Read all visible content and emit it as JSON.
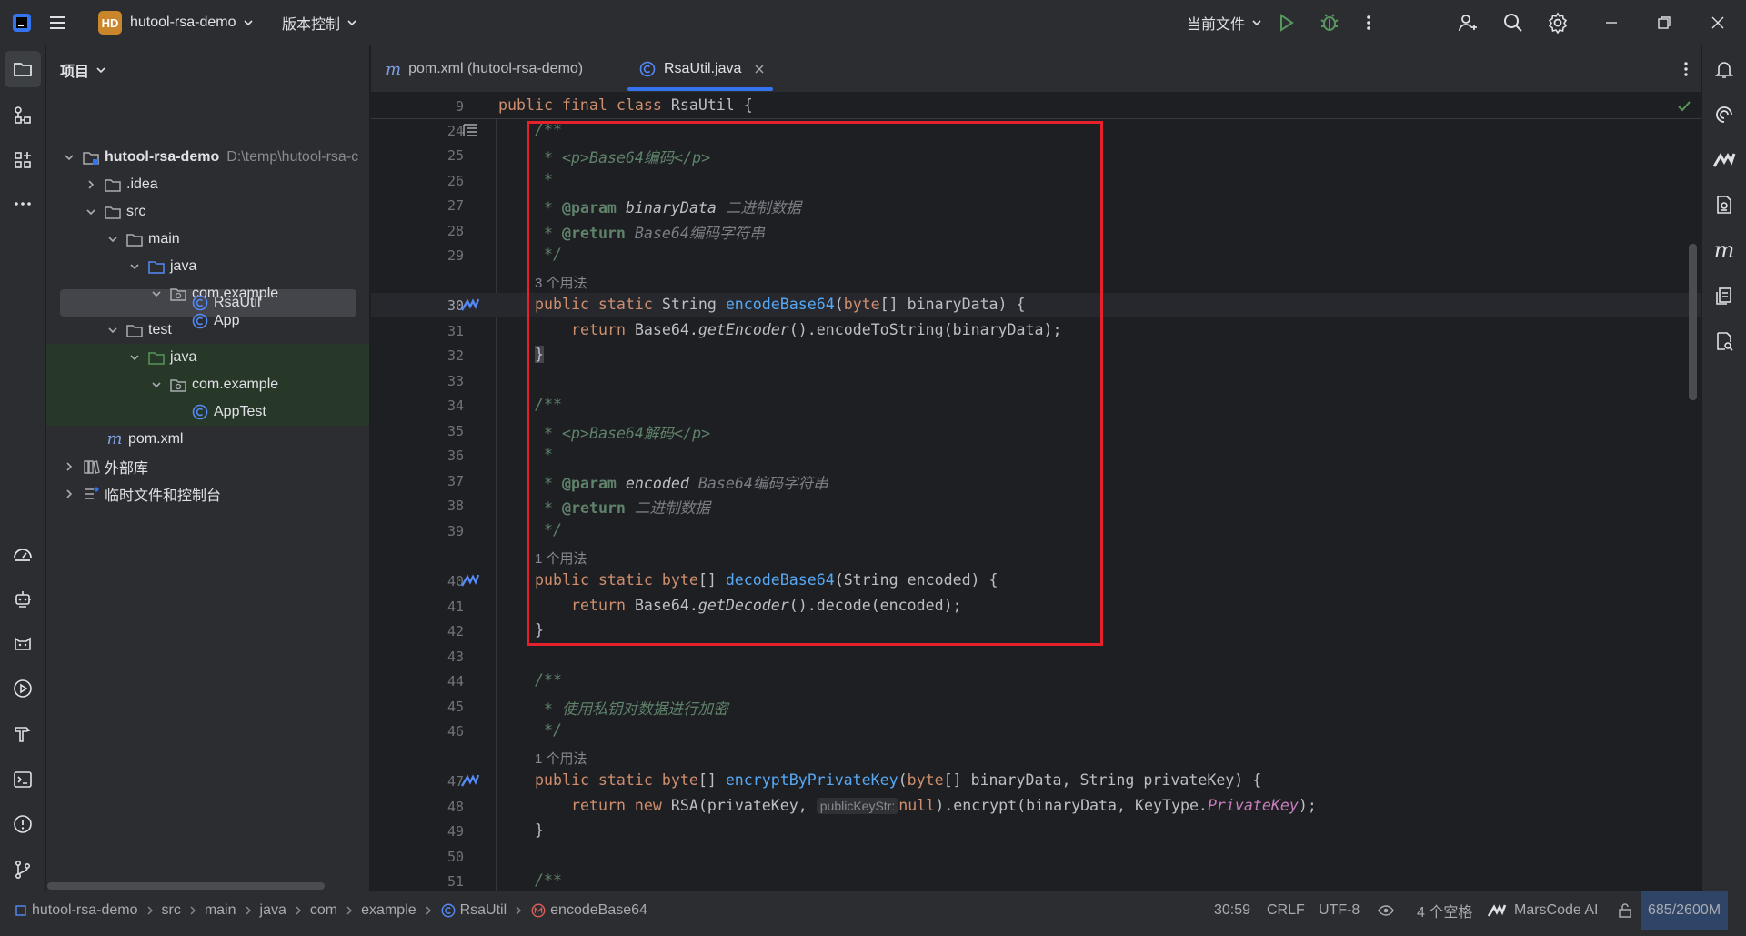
{
  "titlebar": {
    "project_badge": "HD",
    "project_name": "hutool-rsa-demo",
    "vcs_label": "版本控制",
    "run_config": "当前文件"
  },
  "project_panel": {
    "title": "项目",
    "tree": [
      {
        "label": "hutool-rsa-demo",
        "path": "D:\\temp\\hutool-rsa-c"
      },
      {
        "label": ".idea"
      },
      {
        "label": "src"
      },
      {
        "label": "main"
      },
      {
        "label": "java"
      },
      {
        "label": "com.example"
      },
      {
        "label": "App"
      },
      {
        "label": "RsaUtil"
      },
      {
        "label": "test"
      },
      {
        "label": "java"
      },
      {
        "label": "com.example"
      },
      {
        "label": "AppTest"
      },
      {
        "label": "pom.xml"
      },
      {
        "label": "外部库"
      },
      {
        "label": "临时文件和控制台"
      }
    ]
  },
  "tabs": [
    {
      "label": "pom.xml (hutool-rsa-demo)"
    },
    {
      "label": "RsaUtil.java"
    }
  ],
  "editor": {
    "sticky_line": "9",
    "sticky_code": [
      "public",
      "final",
      "class",
      "RsaUtil {"
    ],
    "usage_hints": [
      "3 个用法",
      "1 个用法",
      "1 个用法"
    ],
    "inlay_hint": "publicKeyStr:",
    "line_numbers": [
      "24",
      "25",
      "26",
      "27",
      "28",
      "29",
      "30",
      "31",
      "32",
      "33",
      "34",
      "35",
      "36",
      "37",
      "38",
      "39",
      "40",
      "41",
      "42",
      "43",
      "44",
      "45",
      "46",
      "47",
      "48",
      "49",
      "50",
      "51"
    ],
    "lines": {
      "l24": "/**",
      "l25_star": " * ",
      "l25_tag1": "<p>",
      "l25_txt": "Base64编码",
      "l25_tag2": "</p>",
      "l26": " *",
      "l27_star": " * ",
      "l27_tag": "@param",
      "l27_name": " binaryData",
      "l27_desc": " 二进制数据",
      "l28_star": " * ",
      "l28_tag": "@return",
      "l28_desc": " Base64编码字符串",
      "l29": " */",
      "l30_a": "public static ",
      "l30_b": "String ",
      "l30_fn": "encodeBase64",
      "l30_c": "(",
      "l30_d": "byte",
      "l30_e": "[] binaryData) {",
      "l31_kw": "return ",
      "l31_a": "Base64.",
      "l31_b": "getEncoder",
      "l31_c": "().encodeToString(binaryData);",
      "l32": "}",
      "l34": "/**",
      "l35_star": " * ",
      "l35_tag1": "<p>",
      "l35_txt": "Base64解码",
      "l35_tag2": "</p>",
      "l36": " *",
      "l37_star": " * ",
      "l37_tag": "@param",
      "l37_name": " encoded",
      "l37_desc": " Base64编码字符串",
      "l38_star": " * ",
      "l38_tag": "@return",
      "l38_desc": " 二进制数据",
      "l39": " */",
      "l40_a": "public static byte",
      "l40_b": "[] ",
      "l40_fn": "decodeBase64",
      "l40_c": "(String encoded) {",
      "l41_kw": "return ",
      "l41_a": "Base64.",
      "l41_b": "getDecoder",
      "l41_c": "().decode(encoded);",
      "l42": "}",
      "l44": "/**",
      "l45": " * 使用私钥对数据进行加密",
      "l46": " */",
      "l47_a": "public static byte",
      "l47_b": "[] ",
      "l47_fn": "encryptByPrivateKey",
      "l47_c": "(",
      "l47_d": "byte",
      "l47_e": "[] binaryData, String privateKey) {",
      "l48_kw": "return new ",
      "l48_a": "RSA(privateKey, ",
      "l48_null": "null",
      "l48_b": ").encrypt(binaryData, KeyType.",
      "l48_c": "PrivateKey",
      "l48_d": ");",
      "l49": "}",
      "l51": "/**"
    }
  },
  "statusbar": {
    "breadcrumbs": [
      "hutool-rsa-demo",
      "src",
      "main",
      "java",
      "com",
      "example",
      "RsaUtil",
      "encodeBase64"
    ],
    "position": "30:59",
    "line_ending": "CRLF",
    "encoding": "UTF-8",
    "indent": "4 个空格",
    "ai_plugin": "MarsCode AI",
    "memory": "685/2600M"
  },
  "colors": {
    "highlight_box": "#e5212b",
    "accent": "#3574f0",
    "badge": "#c9862b"
  }
}
